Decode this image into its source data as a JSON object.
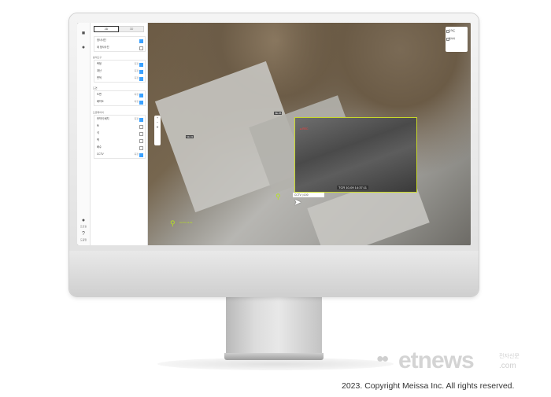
{
  "sidebar": {
    "tabs": [
      {
        "label": "2D"
      },
      {
        "label": "3D"
      }
    ],
    "rail": {
      "profile_label": "프로필",
      "help_label": "도움말"
    },
    "group1": [
      {
        "label": "정사사진"
      },
      {
        "label": "새 정사사진"
      }
    ],
    "section2_title": "분석도구",
    "group2": [
      {
        "label": "측정",
        "value": "측정"
      },
      {
        "label": "계산",
        "value": "측정"
      },
      {
        "label": "면적",
        "value": "측정"
      }
    ],
    "section3_title": "도면",
    "group3": [
      {
        "label": "도면",
        "value": "측정"
      },
      {
        "label": "배치도",
        "value": "측정"
      }
    ],
    "section4_title": "도면레이어",
    "group4": [
      {
        "label": "흙막이 배치",
        "value": "측정"
      },
      {
        "label": "토",
        "value": ""
      },
      {
        "label": "석",
        "value": ""
      },
      {
        "label": "벽",
        "value": ""
      },
      {
        "label": "배수",
        "value": ""
      },
      {
        "label": "CCTV",
        "value": "측정"
      }
    ]
  },
  "map": {
    "legend": [
      {
        "label": "구역도"
      },
      {
        "label": "레이어"
      }
    ],
    "zoom": {
      "plus": "+",
      "minus": "−",
      "reset": "⌖"
    },
    "markers": [
      {
        "label": "SE-05"
      },
      {
        "label": "SE-01"
      }
    ],
    "video": {
      "timestamp": "TCR 10-09 14:37:11",
      "rec": "● REC"
    },
    "cctv_label": "CCTV | 4.00",
    "pin_label": "CCTV 12-01"
  },
  "footer": {
    "brand": "etnews",
    "brand_sub": ".com",
    "brand_cn": "전자신문",
    "copyright": "2023. Copyright Meissa Inc. All rights reserved."
  }
}
